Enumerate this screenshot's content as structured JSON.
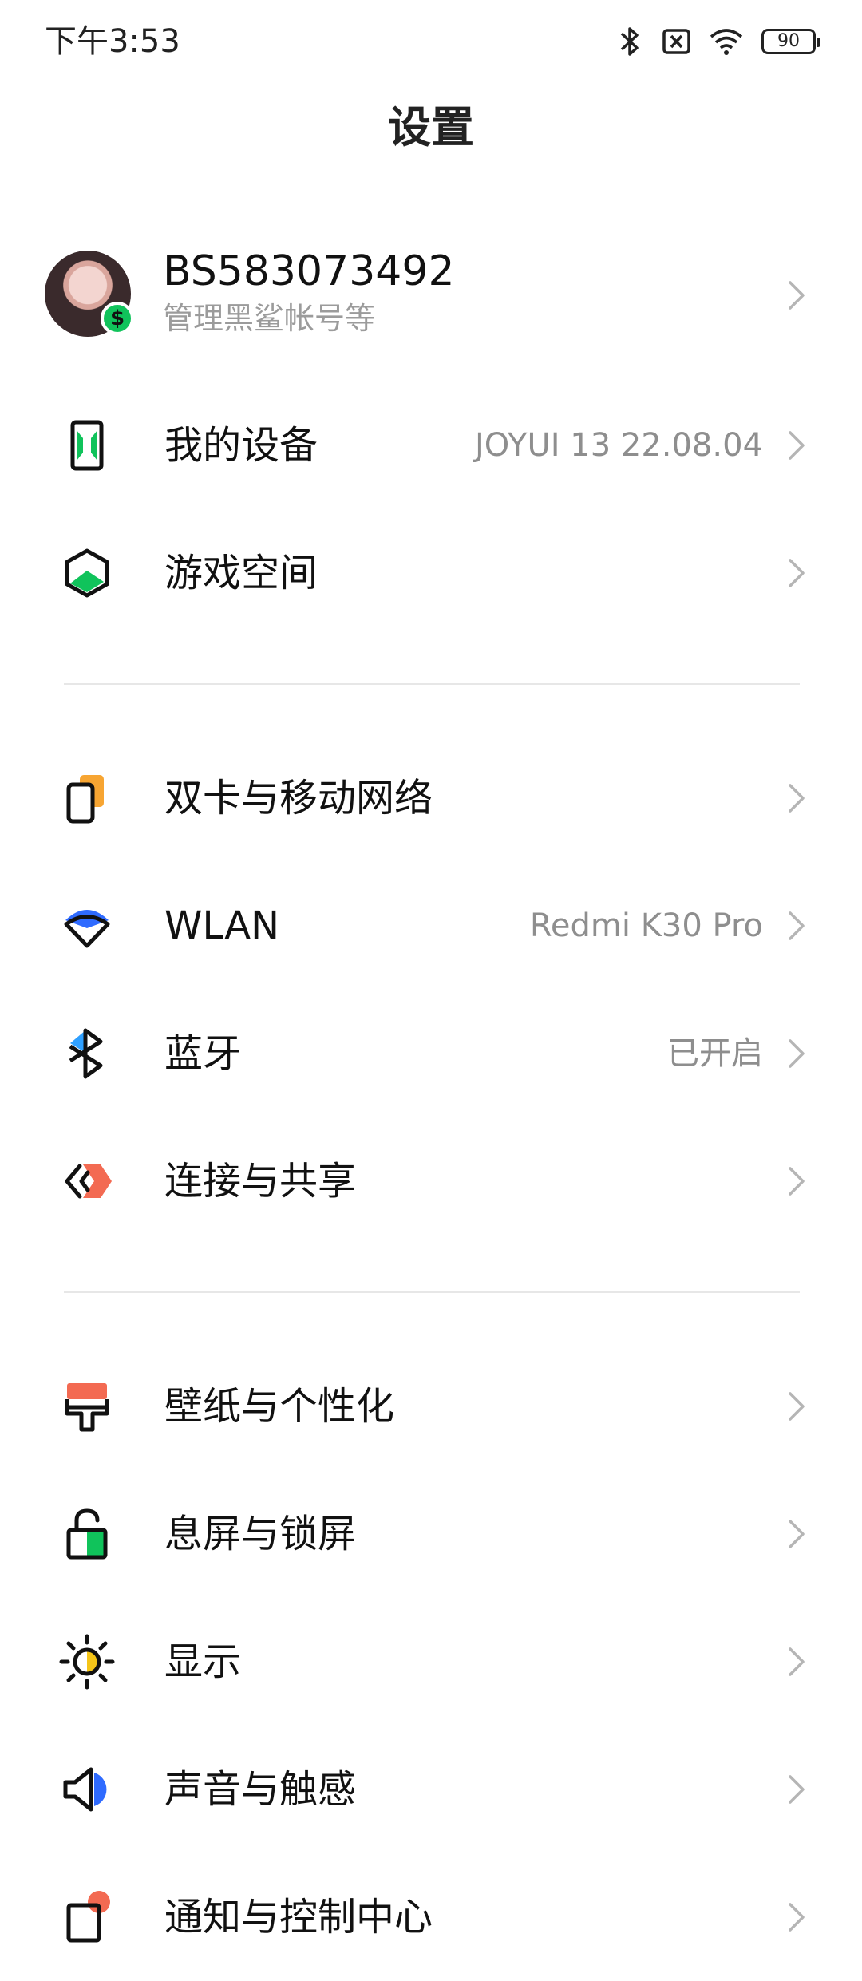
{
  "status_bar": {
    "time": "下午3:53",
    "battery": "90",
    "icons": [
      "bluetooth-icon",
      "no-sim-icon",
      "wifi-icon",
      "battery-icon"
    ]
  },
  "header": {
    "title": "设置"
  },
  "account": {
    "name": "BS583073492",
    "subtitle": "管理黑鲨帐号等"
  },
  "sections": [
    {
      "items": [
        {
          "label": "我的设备",
          "value": "JOYUI 13 22.08.04",
          "icon": "phone-device-icon"
        },
        {
          "label": "游戏空间",
          "value": "",
          "icon": "game-space-icon"
        }
      ]
    },
    {
      "items": [
        {
          "label": "双卡与移动网络",
          "value": "",
          "icon": "sim-cards-icon"
        },
        {
          "label": "WLAN",
          "value": "Redmi K30 Pro",
          "icon": "wlan-icon"
        },
        {
          "label": "蓝牙",
          "value": "已开启",
          "icon": "bluetooth-icon"
        },
        {
          "label": "连接与共享",
          "value": "",
          "icon": "connection-share-icon"
        }
      ]
    },
    {
      "items": [
        {
          "label": "壁纸与个性化",
          "value": "",
          "icon": "wallpaper-icon"
        },
        {
          "label": "息屏与锁屏",
          "value": "",
          "icon": "lock-screen-icon"
        },
        {
          "label": "显示",
          "value": "",
          "icon": "display-brightness-icon"
        },
        {
          "label": "声音与触感",
          "value": "",
          "icon": "sound-icon"
        },
        {
          "label": "通知与控制中心",
          "value": "",
          "icon": "notification-icon"
        }
      ]
    }
  ],
  "colors": {
    "accent_green": "#10c35b",
    "accent_blue": "#2f6bff",
    "accent_orange": "#f7a532",
    "accent_red": "#f36a52",
    "text_secondary": "#8e8e8e"
  }
}
